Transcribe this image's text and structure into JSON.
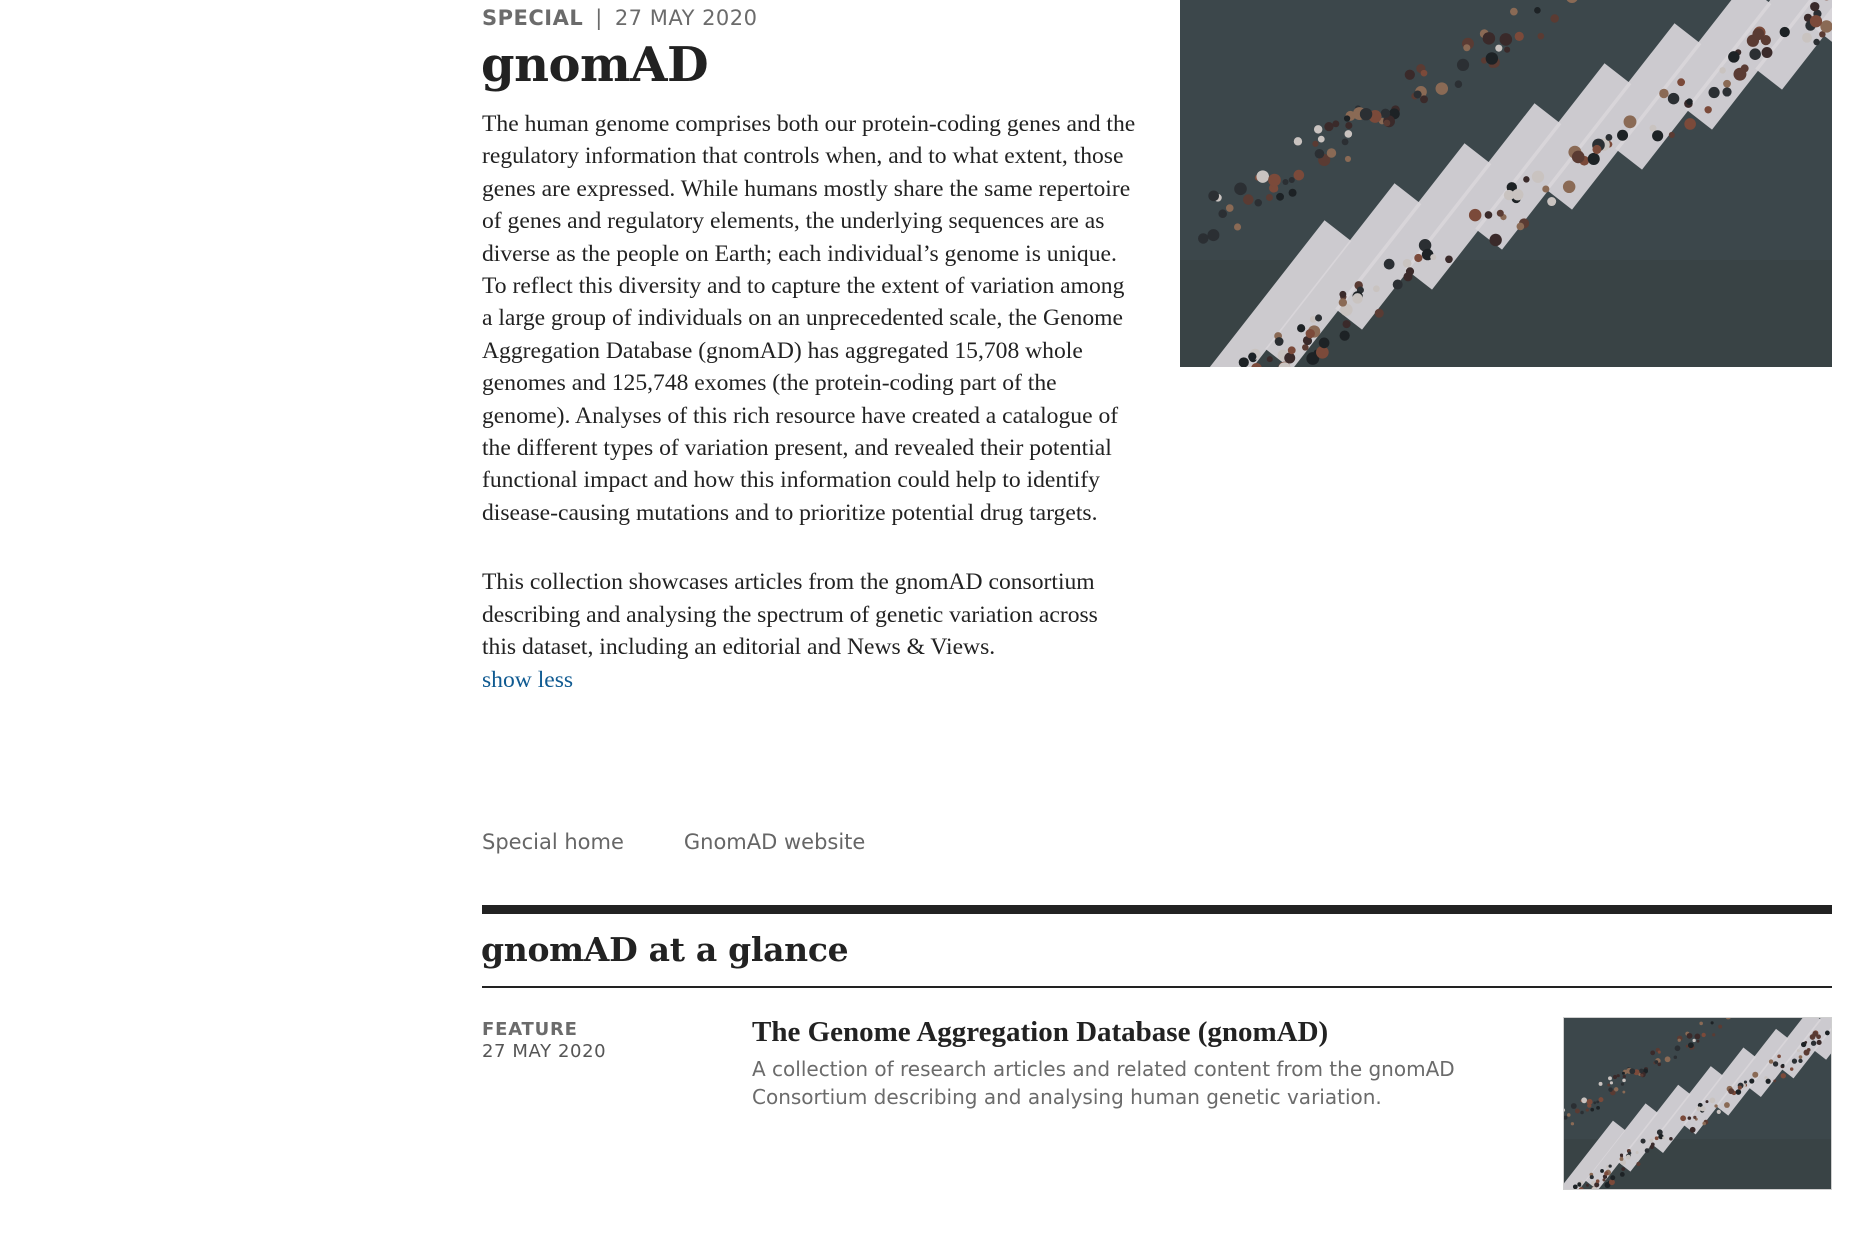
{
  "header": {
    "kind": "SPECIAL",
    "separator": "|",
    "date": "27 MAY 2020",
    "title": "gnomAD"
  },
  "description": {
    "paragraph_1": "The human genome comprises both our protein-coding genes and the regulatory information that controls when, and to what extent, those genes are expressed. While humans mostly share the same repertoire of genes and regulatory elements, the underlying sequences are as diverse as the people on Earth; each individual’s genome is unique. To reflect this diversity and to capture the extent of variation among a large group of individuals on an unprecedented scale, the Genome Aggregation Database (gnomAD) has aggregated 15,708 whole genomes and 125,748 exomes (the protein-coding part of the genome). Analyses of this rich resource have created a catalogue of the different types of variation present, and revealed their potential functional impact and how this information could help to identify disease-causing mutations and to prioritize potential drug targets.",
    "paragraph_2": "This collection showcases articles from the gnomAD consortium describing and analysing the spectrum of genetic variation across this dataset, including an editorial and News & Views.",
    "toggle_label": "show less"
  },
  "links": {
    "special_home": "Special home",
    "gnomad_website": "GnomAD website"
  },
  "section": {
    "title": "gnomAD at a glance"
  },
  "items": [
    {
      "kind": "FEATURE",
      "date": "27 MAY 2020",
      "title": "The Genome Aggregation Database (gnomAD)",
      "description": "A collection of research articles and related content from the gnomAD Consortium describing and analysing human genetic variation."
    }
  ],
  "colors": {
    "link": "#0f5a91",
    "text": "#222222",
    "muted": "#6b6b6b"
  }
}
